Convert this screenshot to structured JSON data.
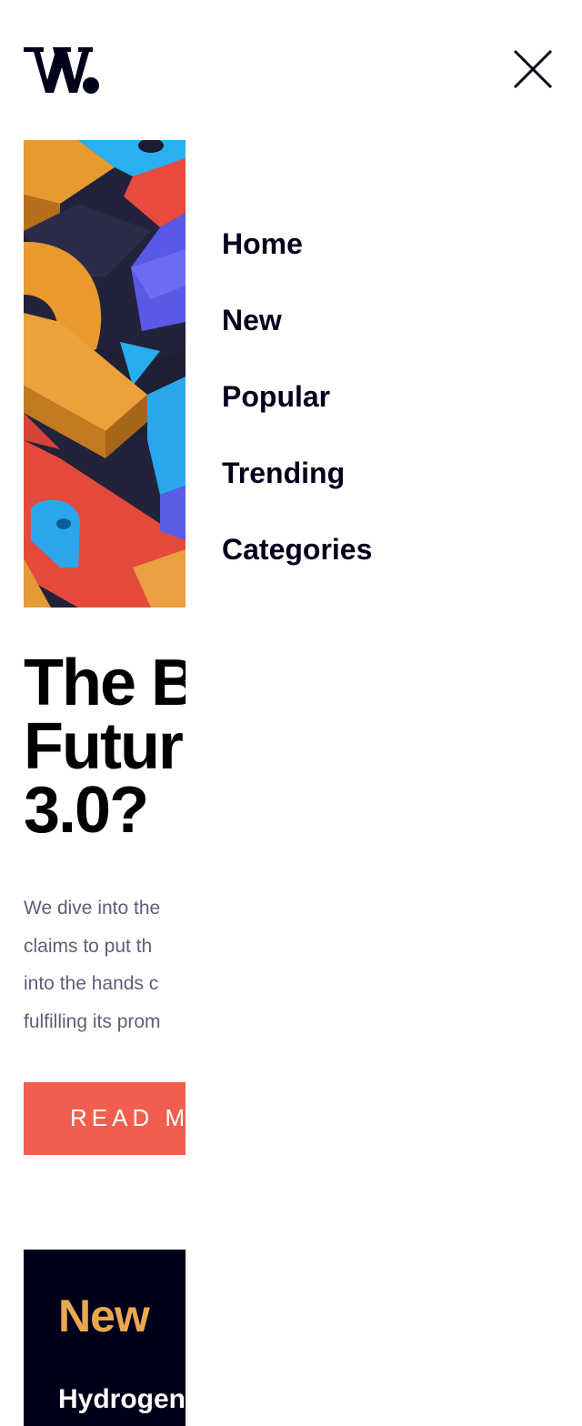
{
  "logo": {
    "text": "W.",
    "icon": "w-logo"
  },
  "close_icon": "close-x-icon",
  "hero": {
    "image_alt": "colorful 3D geometric blocks",
    "headline_lines": [
      "The B",
      "Futur",
      "3.0?"
    ],
    "excerpt_lines": [
      "We dive into the",
      "claims to put th",
      "into the hands c",
      "fulfilling its prom"
    ],
    "read_more_label": "READ M"
  },
  "nav": {
    "items": [
      {
        "label": "Home"
      },
      {
        "label": "New"
      },
      {
        "label": "Popular"
      },
      {
        "label": "Trending"
      },
      {
        "label": "Categories"
      }
    ]
  },
  "new_section": {
    "title": "New",
    "first_item": "Hydrogen"
  },
  "colors": {
    "navy": "#00001a",
    "accent_red": "#f15e50",
    "accent_orange": "#e9a84f",
    "muted_text": "#5d5f79"
  }
}
